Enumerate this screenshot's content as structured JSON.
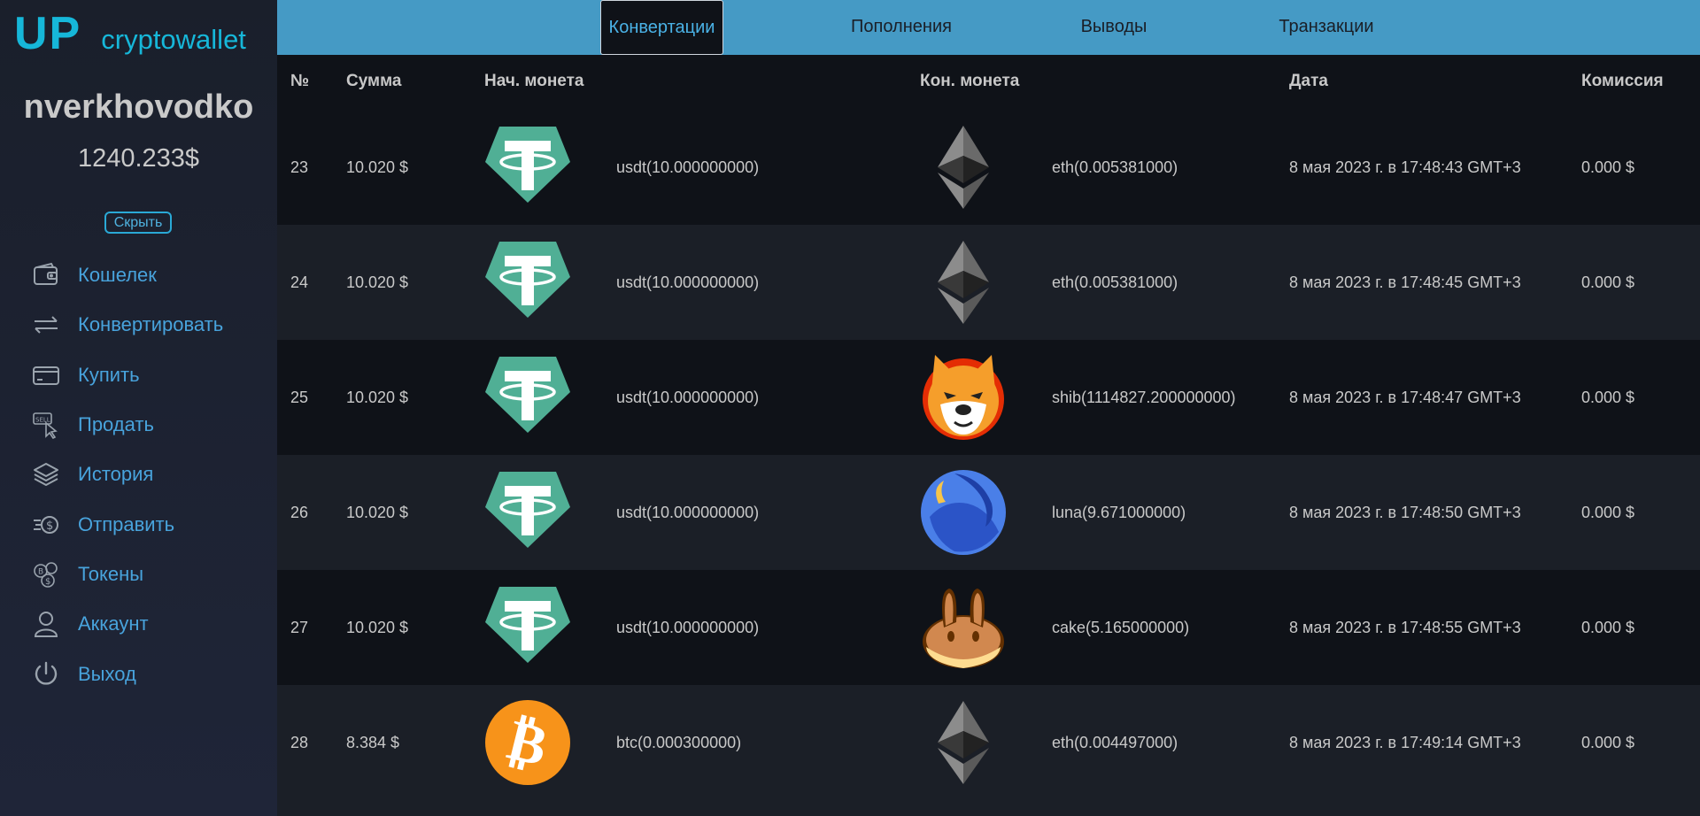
{
  "logo": {
    "up": "UP",
    "name": "cryptowallet"
  },
  "user": {
    "name": "nverkhovodko",
    "balance": "1240.233$",
    "hide_label": "Скрыть"
  },
  "nav": [
    {
      "label": "Кошелек",
      "icon": "wallet-icon"
    },
    {
      "label": "Конвертировать",
      "icon": "convert-arrows-icon"
    },
    {
      "label": "Купить",
      "icon": "credit-card-icon"
    },
    {
      "label": "Продать",
      "icon": "sell-cursor-icon"
    },
    {
      "label": "История",
      "icon": "layers-icon"
    },
    {
      "label": "Отправить",
      "icon": "send-dollar-icon"
    },
    {
      "label": "Токены",
      "icon": "tokens-icon"
    },
    {
      "label": "Аккаунт",
      "icon": "user-icon"
    },
    {
      "label": "Выход",
      "icon": "power-icon"
    }
  ],
  "tabs": [
    "Конвертации",
    "Пополнения",
    "Выводы",
    "Транзакции"
  ],
  "table": {
    "headers": {
      "num": "№",
      "amount": "Сумма",
      "from": "Нач. монета",
      "to": "Кон. монета",
      "date": "Дата",
      "fee": "Комиссия"
    },
    "rows": [
      {
        "num": "23",
        "amount": "10.020 $",
        "from_icon": "usdt",
        "from": "usdt(10.000000000)",
        "to_icon": "eth",
        "to": "eth(0.005381000)",
        "date": "8 мая 2023 г. в 17:48:43 GMT+3",
        "fee": "0.000 $"
      },
      {
        "num": "24",
        "amount": "10.020 $",
        "from_icon": "usdt",
        "from": "usdt(10.000000000)",
        "to_icon": "eth",
        "to": "eth(0.005381000)",
        "date": "8 мая 2023 г. в 17:48:45 GMT+3",
        "fee": "0.000 $"
      },
      {
        "num": "25",
        "amount": "10.020 $",
        "from_icon": "usdt",
        "from": "usdt(10.000000000)",
        "to_icon": "shib",
        "to": "shib(1114827.200000000)",
        "date": "8 мая 2023 г. в 17:48:47 GMT+3",
        "fee": "0.000 $"
      },
      {
        "num": "26",
        "amount": "10.020 $",
        "from_icon": "usdt",
        "from": "usdt(10.000000000)",
        "to_icon": "luna",
        "to": "luna(9.671000000)",
        "date": "8 мая 2023 г. в 17:48:50 GMT+3",
        "fee": "0.000 $"
      },
      {
        "num": "27",
        "amount": "10.020 $",
        "from_icon": "usdt",
        "from": "usdt(10.000000000)",
        "to_icon": "cake",
        "to": "cake(5.165000000)",
        "date": "8 мая 2023 г. в 17:48:55 GMT+3",
        "fee": "0.000 $"
      },
      {
        "num": "28",
        "amount": "8.384 $",
        "from_icon": "btc",
        "from": "btc(0.000300000)",
        "to_icon": "eth",
        "to": "eth(0.004497000)",
        "date": "8 мая 2023 г. в 17:49:14 GMT+3",
        "fee": "0.000 $"
      }
    ]
  },
  "colors": {
    "accent": "#16b7d9",
    "topbar": "#459ac5",
    "nav_text": "#48a3dc"
  }
}
